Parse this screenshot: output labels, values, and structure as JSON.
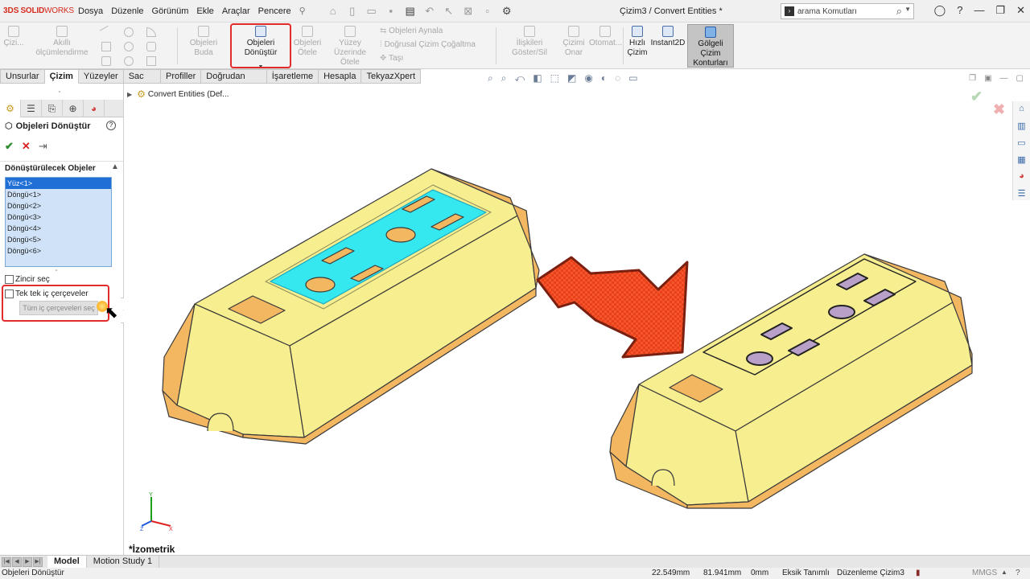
{
  "app": {
    "brand_solid": "SOLID",
    "brand_works": "WORKS",
    "document_title": "Çizim3 / Convert Entities *"
  },
  "menu": [
    "Dosya",
    "Düzenle",
    "Görünüm",
    "Ekle",
    "Araçlar",
    "Pencere"
  ],
  "search": {
    "placeholder": "arama Komutları"
  },
  "toolbar": {
    "cizim": "Çizi...",
    "akilli_olcu": "Akıllı ölçümlendirme",
    "objeleri_buda": "Objeleri Buda",
    "objeleri_donustur": "Objeleri Dönüştür",
    "objeleri_otele": "Objeleri Ötele",
    "yuzey_uzerinde_otele": "Yüzey Üzerinde Ötele",
    "objeleri_aynala": "Objeleri Aynala",
    "dogrusal_cizim": "Doğrusal Çizim Çoğaltma",
    "tasi": "Taşı",
    "iliskileri_goster": "İlişkileri Göster/Sil",
    "cizimi_onar": "Çizimi Onar",
    "otomatik": "Otomat...",
    "hizli_cizim": "Hızlı Çizim",
    "instant2d": "Instant2D",
    "golgeli_cizim": "Gölgeli Çizim Konturları"
  },
  "tabs": [
    "Unsurlar",
    "Çizim",
    "Yüzeyler",
    "Sac Levha",
    "Profiller",
    "Doğrudan Düzenleme",
    "İşaretleme",
    "Hesapla",
    "TekyazXpert"
  ],
  "active_tab": "Çizim",
  "property_manager": {
    "title": "Objeleri Dönüştür",
    "help": "?",
    "group_title": "Dönüştürülecek Objeler",
    "entities": [
      "Yüz<1>",
      "Döngü<1>",
      "Döngü<2>",
      "Döngü<3>",
      "Döngü<4>",
      "Döngü<5>",
      "Döngü<6>"
    ],
    "selected_entity": "Yüz<1>",
    "chain_select": "Zincir seç",
    "single_inner": "Tek tek iç çerçeveler",
    "all_inner_button": "Tüm iç çerçeveleri seç"
  },
  "viewport": {
    "tree_item": "Convert Entities (Def...",
    "view_label": "*İzometrik"
  },
  "bottom_tabs": [
    "Model",
    "Motion Study 1"
  ],
  "active_bottom_tab": "Model",
  "status": {
    "left": "Objeleri Dönüştür",
    "x": "22.549mm",
    "y": "81.941mm",
    "z": "0mm",
    "definition": "Eksik Tanımlı",
    "editing": "Düzenleme Çizim3",
    "units": "MMGS"
  },
  "colors": {
    "part_face": "#f6ee8f",
    "part_edge": "#f2b760",
    "selected_face": "#35e8f0",
    "arrow": "#f5552b",
    "highlight": "#e32b2b"
  }
}
